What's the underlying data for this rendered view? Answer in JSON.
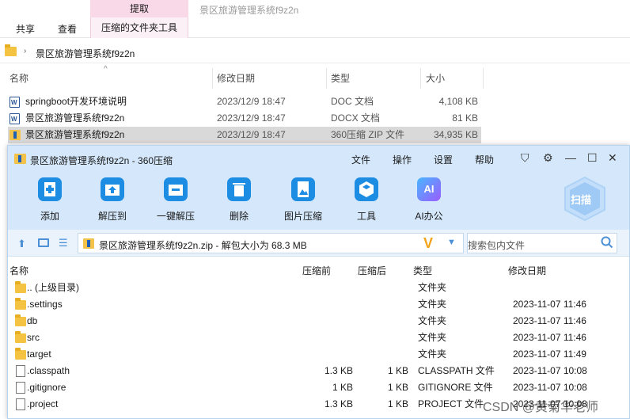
{
  "explorer": {
    "tabs": [
      "共享",
      "查看"
    ],
    "context_tab_header": "提取",
    "context_tab": "压缩的文件夹工具",
    "window_title": "景区旅游管理系统f9z2n",
    "address_path": "景区旅游管理系统f9z2n",
    "columns": {
      "name": "名称",
      "date": "修改日期",
      "type": "类型",
      "size": "大小"
    },
    "files": [
      {
        "name": "springboot开发环境说明",
        "date": "2023/12/9 18:47",
        "type": "DOC 文档",
        "size": "4,108 KB",
        "icon": "word-doc-icon"
      },
      {
        "name": "景区旅游管理系统f9z2n",
        "date": "2023/12/9 18:47",
        "type": "DOCX 文档",
        "size": "81 KB",
        "icon": "word-doc-icon"
      },
      {
        "name": "景区旅游管理系统f9z2n",
        "date": "2023/12/9 18:47",
        "type": "360压缩 ZIP 文件",
        "size": "34,935 KB",
        "icon": "zip-icon",
        "selected": true
      }
    ]
  },
  "zip": {
    "title": "景区旅游管理系统f9z2n - 360压缩",
    "menu": [
      "文件",
      "操作",
      "设置",
      "帮助"
    ],
    "toolbar": [
      "添加",
      "解压到",
      "一键解压",
      "删除",
      "图片压缩",
      "工具",
      "AI办公"
    ],
    "ai_icon_text": "AI",
    "scan_label": "扫描",
    "path": "景区旅游管理系统f9z2n.zip - 解包大小为 68.3 MB",
    "search_placeholder": "搜索包内文件",
    "columns": {
      "name": "名称",
      "compressed": "压缩前",
      "after": "压缩后",
      "type": "类型",
      "modified": "修改日期"
    },
    "rows": [
      {
        "name": ".. (上级目录)",
        "compressed": "",
        "after": "",
        "type": "文件夹",
        "modified": "",
        "kind": "folder"
      },
      {
        "name": ".settings",
        "compressed": "",
        "after": "",
        "type": "文件夹",
        "modified": "2023-11-07 11:46",
        "kind": "folder"
      },
      {
        "name": "db",
        "compressed": "",
        "after": "",
        "type": "文件夹",
        "modified": "2023-11-07 11:46",
        "kind": "folder"
      },
      {
        "name": "src",
        "compressed": "",
        "after": "",
        "type": "文件夹",
        "modified": "2023-11-07 11:46",
        "kind": "folder"
      },
      {
        "name": "target",
        "compressed": "",
        "after": "",
        "type": "文件夹",
        "modified": "2023-11-07 11:49",
        "kind": "folder"
      },
      {
        "name": ".classpath",
        "compressed": "1.3 KB",
        "after": "1 KB",
        "type": "CLASSPATH 文件",
        "modified": "2023-11-07 10:08",
        "kind": "file"
      },
      {
        "name": ".gitignore",
        "compressed": "1 KB",
        "after": "1 KB",
        "type": "GITIGNORE 文件",
        "modified": "2023-11-07 10:08",
        "kind": "file"
      },
      {
        "name": ".project",
        "compressed": "1.3 KB",
        "after": "1 KB",
        "type": "PROJECT 文件",
        "modified": "2023-11-07 10:08",
        "kind": "file"
      }
    ]
  },
  "watermark": "CSDN @黄菊华老师"
}
